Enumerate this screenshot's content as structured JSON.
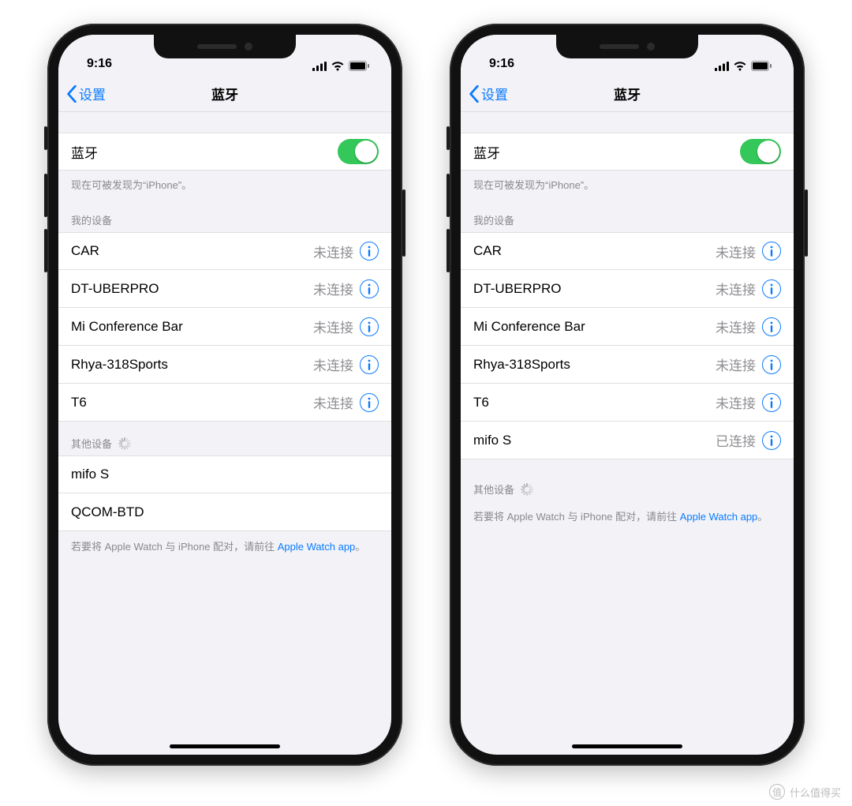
{
  "statusbar": {
    "time": "9:16"
  },
  "nav": {
    "back_label": "设置",
    "title": "蓝牙"
  },
  "toggle_row": {
    "label": "蓝牙"
  },
  "discoverable_note": "现在可被发现为“iPhone”。",
  "sections": {
    "my_devices_header": "我的设备",
    "other_devices_header": "其他设备"
  },
  "watch_note": {
    "prefix": "若要将 Apple Watch 与 iPhone 配对，请前往 ",
    "link": "Apple Watch app",
    "suffix": "。"
  },
  "watermark": "什么值得买",
  "phones": [
    {
      "my_devices": [
        {
          "name": "CAR",
          "status": "未连接"
        },
        {
          "name": "DT-UBERPRO",
          "status": "未连接"
        },
        {
          "name": "Mi Conference Bar",
          "status": "未连接"
        },
        {
          "name": "Rhya-318Sports",
          "status": "未连接"
        },
        {
          "name": "T6",
          "status": "未连接"
        }
      ],
      "other_devices": [
        {
          "name": "mifo S"
        },
        {
          "name": "QCOM-BTD"
        }
      ]
    },
    {
      "my_devices": [
        {
          "name": "CAR",
          "status": "未连接"
        },
        {
          "name": "DT-UBERPRO",
          "status": "未连接"
        },
        {
          "name": "Mi Conference Bar",
          "status": "未连接"
        },
        {
          "name": "Rhya-318Sports",
          "status": "未连接"
        },
        {
          "name": "T6",
          "status": "未连接"
        },
        {
          "name": "mifo S",
          "status": "已连接"
        }
      ],
      "other_devices": []
    }
  ]
}
